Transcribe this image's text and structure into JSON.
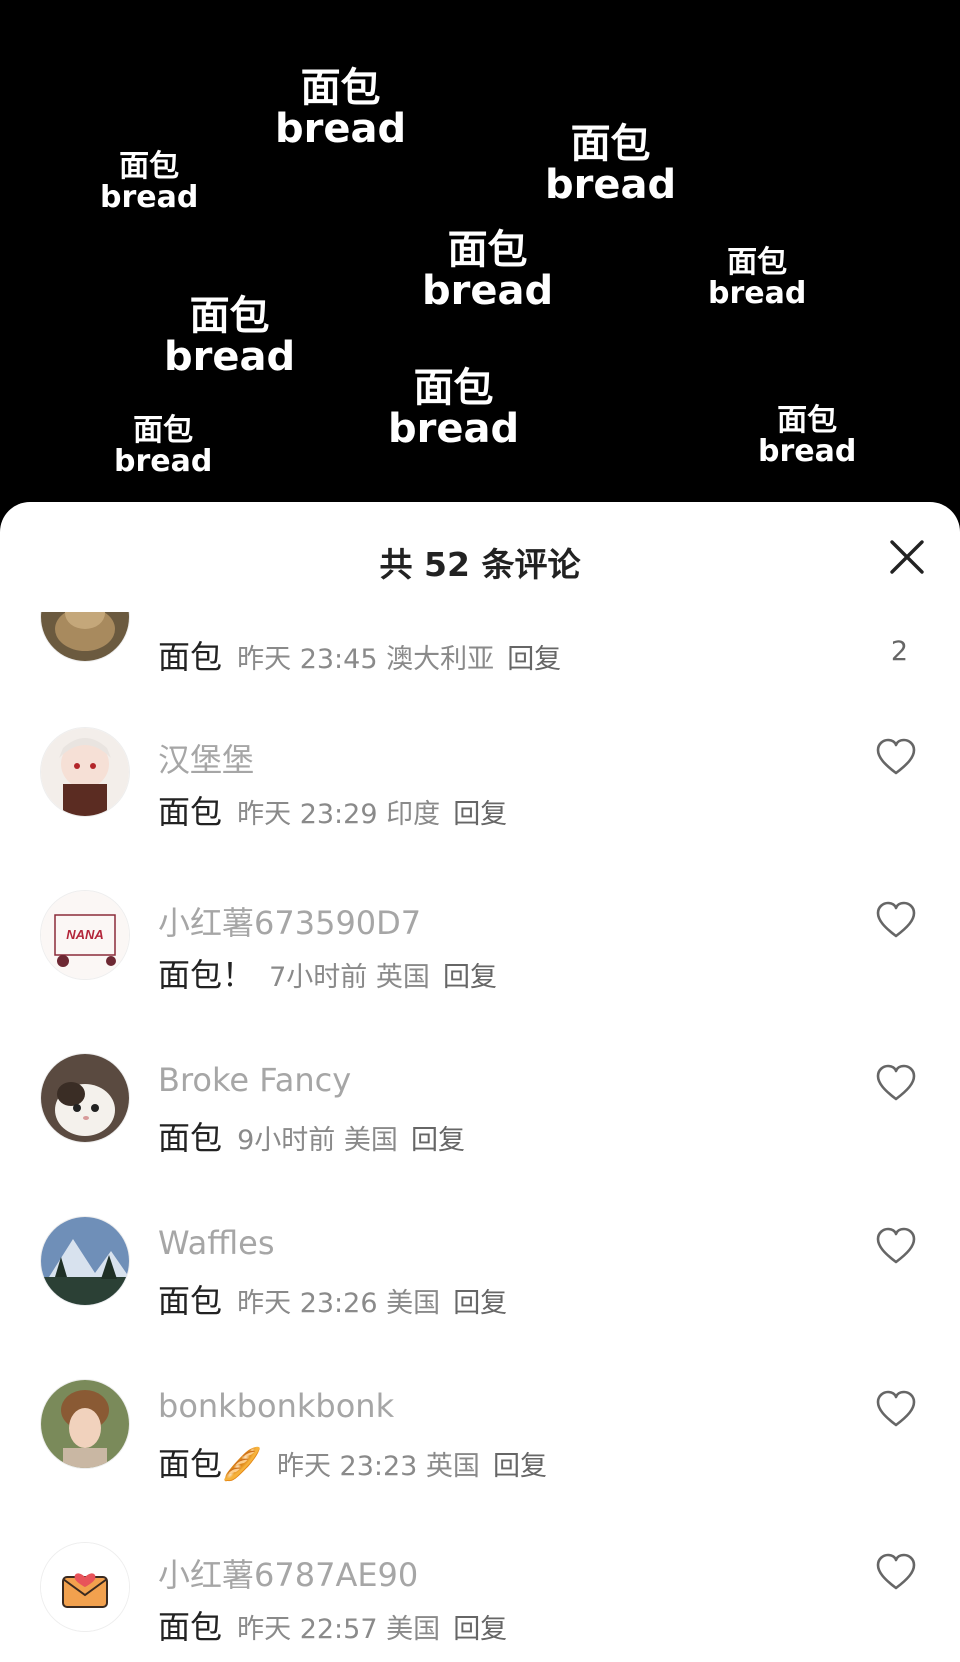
{
  "background_words": [
    {
      "zh": "面包",
      "en": "bread"
    },
    {
      "zh": "面包",
      "en": "bread"
    },
    {
      "zh": "面包",
      "en": "bread"
    },
    {
      "zh": "面包",
      "en": "bread"
    },
    {
      "zh": "面包",
      "en": "bread"
    },
    {
      "zh": "面包",
      "en": "bread"
    },
    {
      "zh": "面包",
      "en": "bread"
    },
    {
      "zh": "面包",
      "en": "bread"
    },
    {
      "zh": "面包",
      "en": "bread"
    }
  ],
  "sheet": {
    "title": "共 52 条评论",
    "close_icon": "close-icon"
  },
  "comments": [
    {
      "username": "",
      "body": "面包",
      "meta": "昨天 23:45 澳大利亚",
      "reply": "回复",
      "likes": "2",
      "avatar_icon": "hamster-avatar"
    },
    {
      "username": "汉堡堡",
      "body": "面包",
      "meta": "昨天 23:29 印度",
      "reply": "回复",
      "likes": "",
      "avatar_icon": "anime-avatar"
    },
    {
      "username": "小红薯673590D7",
      "body": "面包！",
      "meta": "7小时前 英国",
      "reply": "回复",
      "likes": "",
      "avatar_icon": "nana-avatar"
    },
    {
      "username": "Broke Fancy",
      "body": "面包",
      "meta": "9小时前 美国",
      "reply": "回复",
      "likes": "",
      "avatar_icon": "cat-avatar"
    },
    {
      "username": "Waffles",
      "body": "面包",
      "meta": "昨天 23:26 美国",
      "reply": "回复",
      "likes": "",
      "avatar_icon": "mountain-avatar"
    },
    {
      "username": "bonkbonkbonk",
      "body": "面包🥖",
      "meta": "昨天 23:23 英国",
      "reply": "回复",
      "likes": "",
      "avatar_icon": "girl-avatar"
    },
    {
      "username": "小红薯6787AE90",
      "body": "面包",
      "meta": "昨天 22:57 美国",
      "reply": "回复",
      "likes": "",
      "avatar_icon": "envelope-avatar"
    }
  ],
  "colors": {
    "background": "#000000",
    "sheet": "#ffffff",
    "username": "#a6a6a6",
    "meta": "#8a8a8a"
  }
}
